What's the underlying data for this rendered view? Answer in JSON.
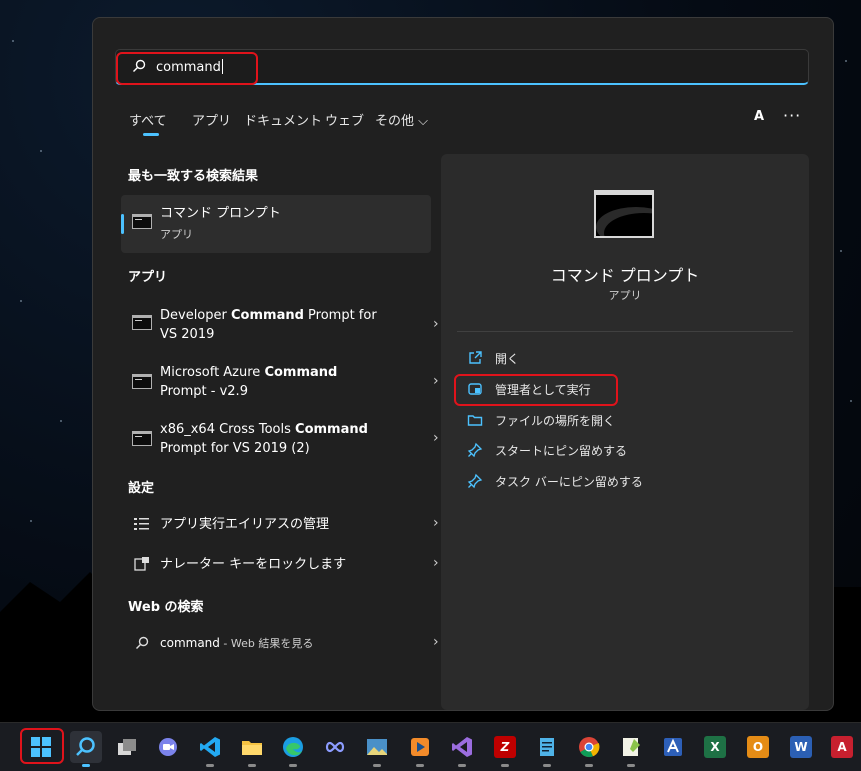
{
  "search": {
    "query": "command"
  },
  "tabs": [
    {
      "label": "すべて",
      "active": true
    },
    {
      "label": "アプリ"
    },
    {
      "label": "ドキュメント"
    },
    {
      "label": "ウェブ"
    },
    {
      "label": "その他 ⌵"
    }
  ],
  "header": {
    "avatar": "A",
    "more": "···"
  },
  "best_match": {
    "section": "最も一致する検索結果",
    "title": "コマンド プロンプト",
    "subtitle": "アプリ"
  },
  "apps": {
    "section": "アプリ",
    "items": [
      {
        "pre": "Developer ",
        "bold": "Command",
        "post": " Prompt for",
        "line2": "VS 2019"
      },
      {
        "pre": "Microsoft Azure ",
        "bold": "Command",
        "post": "",
        "line2": "Prompt - v2.9"
      },
      {
        "pre": "x86_x64 Cross Tools ",
        "bold": "Command",
        "post": "",
        "line2": "Prompt for VS 2019 (2)"
      }
    ]
  },
  "settings": {
    "section": "設定",
    "items": [
      {
        "label": "アプリ実行エイリアスの管理",
        "icon": "list-icon"
      },
      {
        "label": "ナレーター キーをロックします",
        "icon": "narrator-icon"
      }
    ]
  },
  "web": {
    "section": "Web の検索",
    "query": "command",
    "suffix": " - Web 結果を見る"
  },
  "detail": {
    "title": "コマンド プロンプト",
    "subtitle": "アプリ",
    "actions": [
      {
        "label": "開く",
        "icon": "open-external-icon"
      },
      {
        "label": "管理者として実行",
        "icon": "run-as-admin-icon"
      },
      {
        "label": "ファイルの場所を開く",
        "icon": "folder-icon"
      },
      {
        "label": "スタートにピン留めする",
        "icon": "pin-icon"
      },
      {
        "label": "タスク バーにピン留めする",
        "icon": "pin-icon"
      }
    ]
  },
  "chevron": "›",
  "colors": {
    "accent": "#4cc2ff",
    "highlight": "#e0131b",
    "panel": "#202020",
    "detail_panel": "#2b2b2b"
  },
  "taskbar": {
    "icons": [
      "start-icon",
      "search-icon",
      "task-view-icon",
      "teams-chat-icon",
      "vscode-icon",
      "file-explorer-icon",
      "edge-icon",
      "infinity-app-icon",
      "photos-app-icon",
      "media-player-icon",
      "visual-studio-icon",
      "filezilla-icon",
      "notepad-icon",
      "chrome-icon",
      "notepad-plus-icon",
      "access-icon",
      "excel-icon",
      "outlook-icon",
      "word-icon",
      "acrobat-icon"
    ],
    "labels": {
      "filezilla": "Z",
      "excel": "X",
      "outlook": "O",
      "word": "W",
      "acrobat": "A"
    }
  }
}
